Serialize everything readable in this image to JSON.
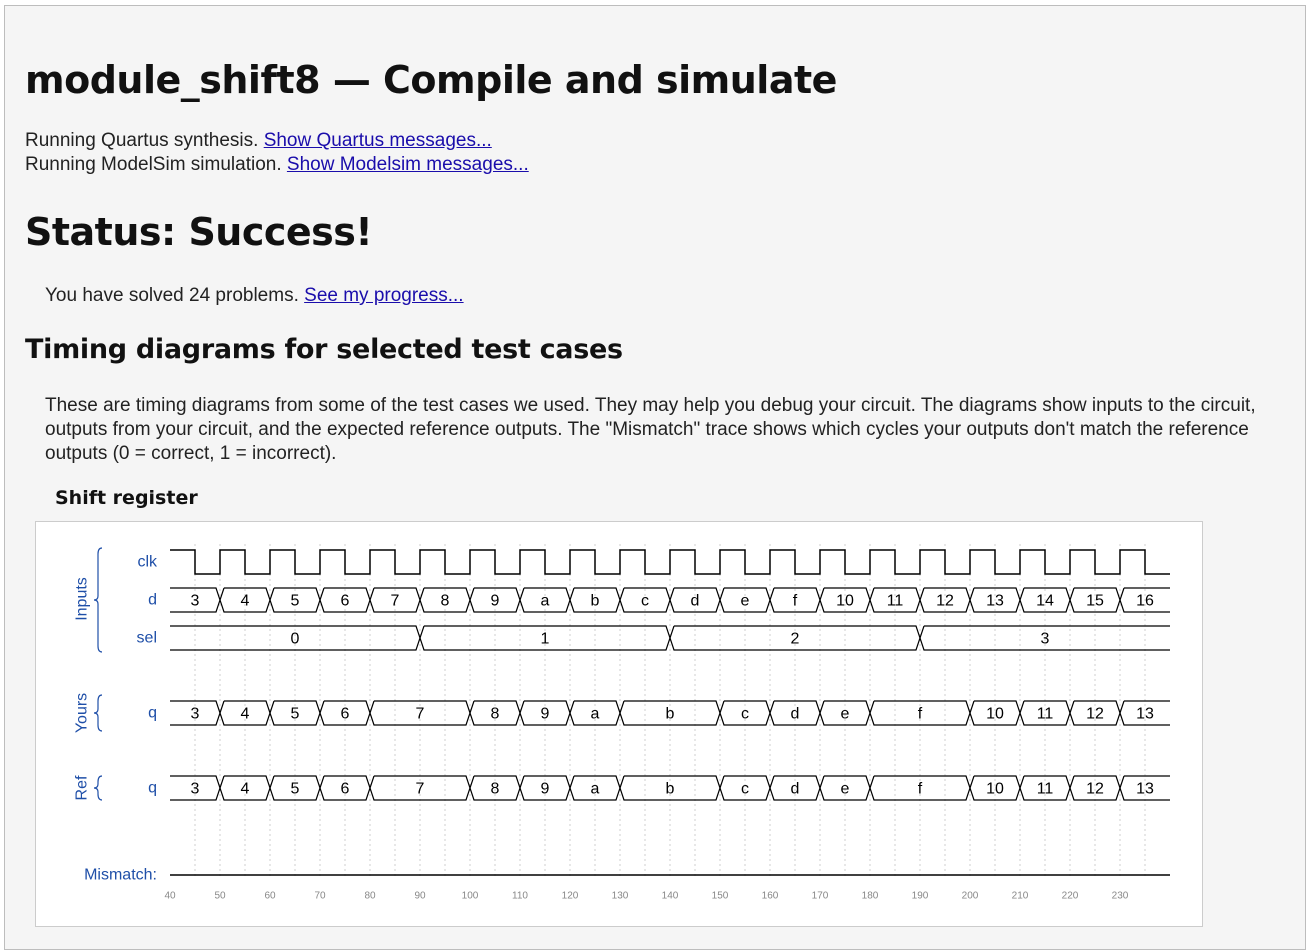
{
  "page": {
    "title": "module_shift8 — Compile and simulate",
    "quartus_text": "Running Quartus synthesis.",
    "quartus_link": "Show Quartus messages...",
    "modelsim_text": "Running ModelSim simulation.",
    "modelsim_link": "Show Modelsim messages...",
    "status": "Status: Success!",
    "solved_text": "You have solved 24 problems.",
    "progress_link": "See my progress...",
    "timing_heading": "Timing diagrams for selected test cases",
    "timing_desc": "These are timing diagrams from some of the test cases we used. They may help you debug your circuit. The diagrams show inputs to the circuit, outputs from your circuit, and the expected reference outputs. The \"Mismatch\" trace shows which cycles your outputs don't match the reference outputs (0 = correct, 1 = incorrect).",
    "diagram_title": "Shift register"
  },
  "waveform": {
    "time_range": [
      40,
      240
    ],
    "time_ticks": [
      40,
      50,
      60,
      70,
      80,
      90,
      100,
      110,
      120,
      130,
      140,
      150,
      160,
      170,
      180,
      190,
      200,
      210,
      220,
      230
    ],
    "groups": [
      {
        "label": "Inputs",
        "signals": [
          "clk",
          "d",
          "sel"
        ]
      },
      {
        "label": "Yours",
        "signals": [
          "q_yours"
        ]
      },
      {
        "label": "Ref",
        "signals": [
          "q_ref"
        ]
      }
    ],
    "mismatch_label": "Mismatch:",
    "mismatch_value": 0,
    "clk": {
      "label": "clk",
      "period": 10,
      "first_fall": 45
    },
    "d": {
      "label": "d",
      "segments": [
        {
          "start": 40,
          "end": 50,
          "value": "3"
        },
        {
          "start": 50,
          "end": 60,
          "value": "4"
        },
        {
          "start": 60,
          "end": 70,
          "value": "5"
        },
        {
          "start": 70,
          "end": 80,
          "value": "6"
        },
        {
          "start": 80,
          "end": 90,
          "value": "7"
        },
        {
          "start": 90,
          "end": 100,
          "value": "8"
        },
        {
          "start": 100,
          "end": 110,
          "value": "9"
        },
        {
          "start": 110,
          "end": 120,
          "value": "a"
        },
        {
          "start": 120,
          "end": 130,
          "value": "b"
        },
        {
          "start": 130,
          "end": 140,
          "value": "c"
        },
        {
          "start": 140,
          "end": 150,
          "value": "d"
        },
        {
          "start": 150,
          "end": 160,
          "value": "e"
        },
        {
          "start": 160,
          "end": 170,
          "value": "f"
        },
        {
          "start": 170,
          "end": 180,
          "value": "10"
        },
        {
          "start": 180,
          "end": 190,
          "value": "11"
        },
        {
          "start": 190,
          "end": 200,
          "value": "12"
        },
        {
          "start": 200,
          "end": 210,
          "value": "13"
        },
        {
          "start": 210,
          "end": 220,
          "value": "14"
        },
        {
          "start": 220,
          "end": 230,
          "value": "15"
        },
        {
          "start": 230,
          "end": 240,
          "value": "16"
        }
      ]
    },
    "sel": {
      "label": "sel",
      "segments": [
        {
          "start": 40,
          "end": 90,
          "value": "0"
        },
        {
          "start": 90,
          "end": 140,
          "value": "1"
        },
        {
          "start": 140,
          "end": 190,
          "value": "2"
        },
        {
          "start": 190,
          "end": 240,
          "value": "3"
        }
      ]
    },
    "q_yours": {
      "label": "q",
      "segments": [
        {
          "start": 40,
          "end": 50,
          "value": "3"
        },
        {
          "start": 50,
          "end": 60,
          "value": "4"
        },
        {
          "start": 60,
          "end": 70,
          "value": "5"
        },
        {
          "start": 70,
          "end": 80,
          "value": "6"
        },
        {
          "start": 80,
          "end": 100,
          "value": "7"
        },
        {
          "start": 100,
          "end": 110,
          "value": "8"
        },
        {
          "start": 110,
          "end": 120,
          "value": "9"
        },
        {
          "start": 120,
          "end": 130,
          "value": "a"
        },
        {
          "start": 130,
          "end": 150,
          "value": "b"
        },
        {
          "start": 150,
          "end": 160,
          "value": "c"
        },
        {
          "start": 160,
          "end": 170,
          "value": "d"
        },
        {
          "start": 170,
          "end": 180,
          "value": "e"
        },
        {
          "start": 180,
          "end": 200,
          "value": "f"
        },
        {
          "start": 200,
          "end": 210,
          "value": "10"
        },
        {
          "start": 210,
          "end": 220,
          "value": "11"
        },
        {
          "start": 220,
          "end": 230,
          "value": "12"
        },
        {
          "start": 230,
          "end": 240,
          "value": "13"
        }
      ]
    },
    "q_ref": {
      "label": "q",
      "segments": [
        {
          "start": 40,
          "end": 50,
          "value": "3"
        },
        {
          "start": 50,
          "end": 60,
          "value": "4"
        },
        {
          "start": 60,
          "end": 70,
          "value": "5"
        },
        {
          "start": 70,
          "end": 80,
          "value": "6"
        },
        {
          "start": 80,
          "end": 100,
          "value": "7"
        },
        {
          "start": 100,
          "end": 110,
          "value": "8"
        },
        {
          "start": 110,
          "end": 120,
          "value": "9"
        },
        {
          "start": 120,
          "end": 130,
          "value": "a"
        },
        {
          "start": 130,
          "end": 150,
          "value": "b"
        },
        {
          "start": 150,
          "end": 160,
          "value": "c"
        },
        {
          "start": 160,
          "end": 170,
          "value": "d"
        },
        {
          "start": 170,
          "end": 180,
          "value": "e"
        },
        {
          "start": 180,
          "end": 200,
          "value": "f"
        },
        {
          "start": 200,
          "end": 210,
          "value": "10"
        },
        {
          "start": 210,
          "end": 220,
          "value": "11"
        },
        {
          "start": 220,
          "end": 230,
          "value": "12"
        },
        {
          "start": 230,
          "end": 240,
          "value": "13"
        }
      ]
    },
    "colors": {
      "label": "#1f4fa8",
      "trace": "#000000",
      "grid": "#cfcfcf",
      "tick": "#888888"
    }
  }
}
